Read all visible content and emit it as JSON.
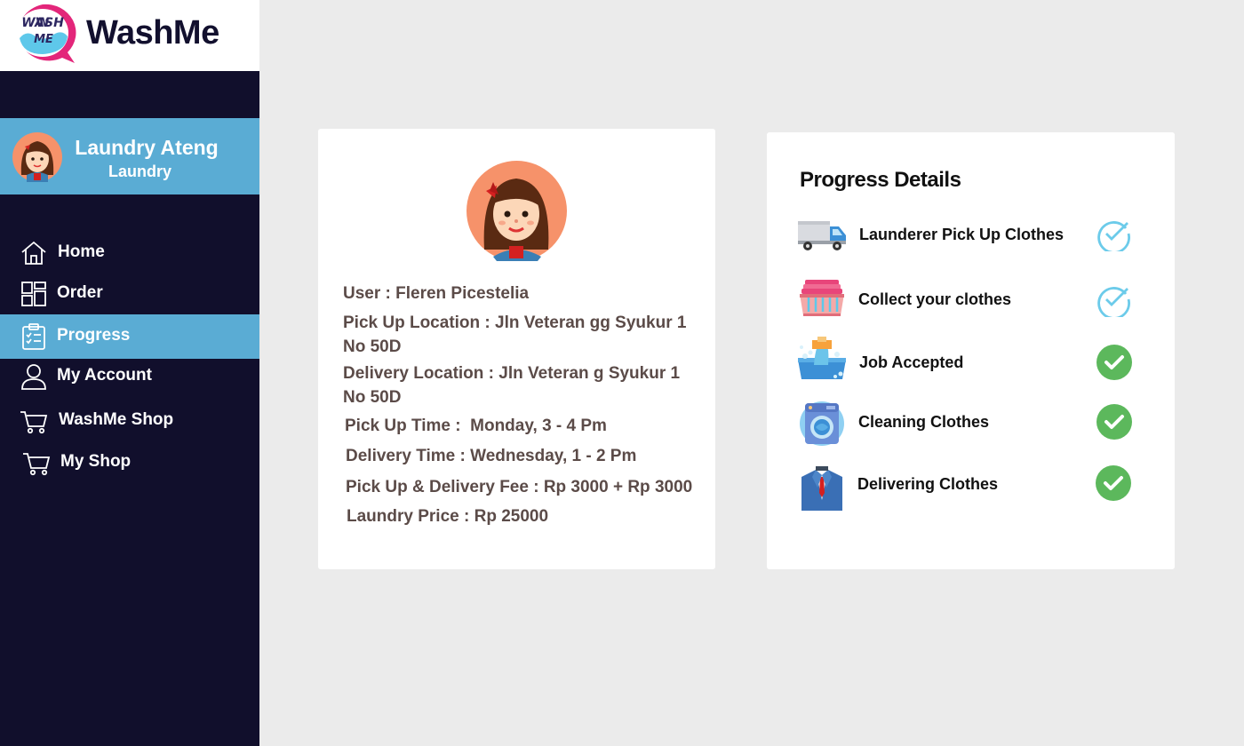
{
  "app": {
    "brand": "WashMe",
    "logo_text": "WASH ME"
  },
  "sidebar": {
    "profile": {
      "name": "Laundry Ateng",
      "role": "Laundry"
    },
    "items": [
      {
        "label": "Home",
        "icon": "home-icon",
        "active": false
      },
      {
        "label": "Order",
        "icon": "dashboard-icon",
        "active": false
      },
      {
        "label": "Progress",
        "icon": "clipboard-checklist-icon",
        "active": true
      },
      {
        "label": "My Account",
        "icon": "user-icon",
        "active": false
      },
      {
        "label": "WashMe Shop",
        "icon": "cart-icon",
        "active": false
      },
      {
        "label": "My Shop",
        "icon": "cart-icon",
        "active": false
      }
    ]
  },
  "order": {
    "user": "User : Fleren Picestelia",
    "pickup_location_1": "Pick Up Location : Jln Veteran gg Syukur 1",
    "pickup_location_2": "No 50D",
    "delivery_location_1": "Delivery Location : Jln Veteran g Syukur 1",
    "delivery_location_2": "No 50D",
    "pickup_time": "Pick Up Time :  Monday, 3 - 4 Pm",
    "delivery_time": "Delivery Time : Wednesday, 1 - 2 Pm",
    "fee": "Pick Up & Delivery Fee : Rp 3000 + Rp 3000",
    "price": "Laundry Price : Rp 25000"
  },
  "progress": {
    "title": "Progress Details",
    "steps": [
      {
        "label": "Launderer Pick Up Clothes",
        "icon": "truck-icon",
        "status": "outline-check"
      },
      {
        "label": "Collect your clothes",
        "icon": "laundry-basket-icon",
        "status": "outline-check"
      },
      {
        "label": "Job Accepted",
        "icon": "hand-washing-icon",
        "status": "filled-check"
      },
      {
        "label": "Cleaning Clothes",
        "icon": "washing-machine-icon",
        "status": "filled-check"
      },
      {
        "label": "Delivering Clothes",
        "icon": "suit-icon",
        "status": "filled-check"
      }
    ]
  },
  "colors": {
    "sidebar_bg": "#110f2c",
    "accent": "#5aacd4",
    "page_bg": "#ebebeb",
    "check_outline": "#6ccbea",
    "check_filled": "#5cb85c",
    "info_text": "#5b4b48"
  }
}
